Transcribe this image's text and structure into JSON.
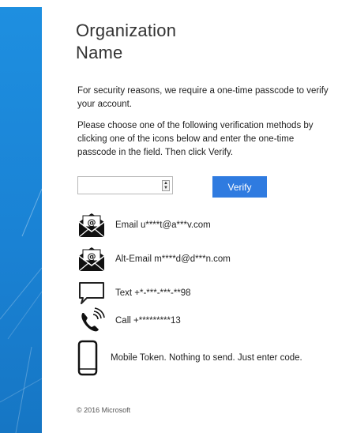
{
  "colors": {
    "side_panel": "#1a82d4",
    "accent": "#2f7be0",
    "text": "#222222"
  },
  "header": {
    "org_line1": "Organization",
    "org_line2": "Name"
  },
  "intro": {
    "security_text": "For security reasons, we require a one-time passcode to verify your account.",
    "instructions_text": "Please choose one of the following verification methods by clicking one of the icons below and enter the one-time passcode in the field. Then click Verify."
  },
  "form": {
    "passcode_value": "",
    "verify_label": "Verify"
  },
  "methods": [
    {
      "icon": "envelope-icon",
      "label": "Email u****t@a***v.com"
    },
    {
      "icon": "envelope-icon",
      "label": "Alt-Email m****d@d***n.com"
    },
    {
      "icon": "chat-bubble-icon",
      "label": "Text +*-***-***-**98"
    },
    {
      "icon": "phone-icon",
      "label": "Call +*********13"
    },
    {
      "icon": "mobile-phone-icon",
      "label": "Mobile Token. Nothing to send. Just enter code."
    }
  ],
  "footer": {
    "copyright": "© 2016 Microsoft"
  }
}
